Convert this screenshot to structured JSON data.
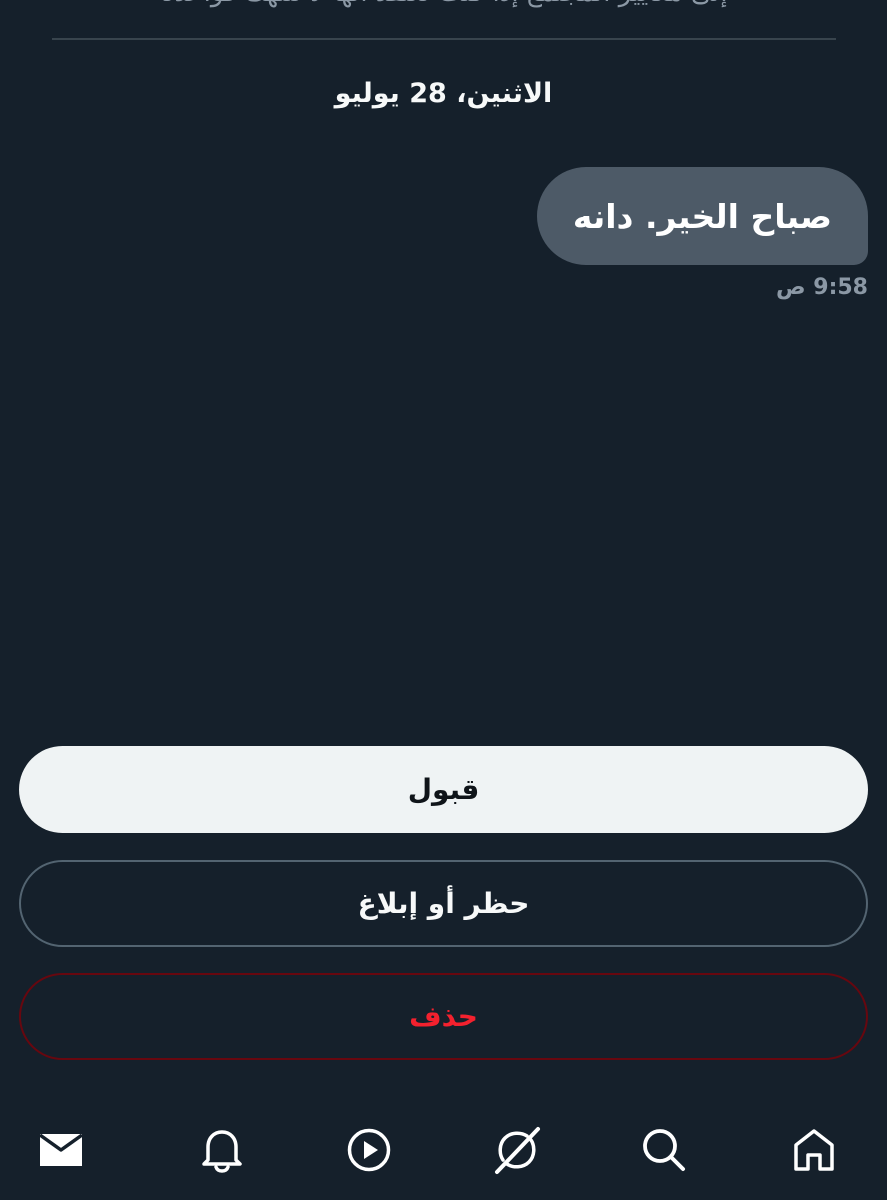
{
  "header": {
    "top_text": "إلى معايير المجتمع إذا كنت تعتقد أنها لا تنتهك قواعدنا"
  },
  "conversation": {
    "date_label": "الاثنين، 28 يوليو",
    "messages": [
      {
        "text": "صباح الخير. دانه",
        "time": "9:58 ص"
      }
    ]
  },
  "actions": {
    "accept_label": "قبول",
    "block_report_label": "حظر أو إبلاغ",
    "delete_label": "حذف"
  },
  "bottom_nav": {
    "items": [
      {
        "icon": "mail-icon",
        "active": true
      },
      {
        "icon": "bell-icon",
        "active": false
      },
      {
        "icon": "play-icon",
        "active": false
      },
      {
        "icon": "grok-icon",
        "active": false
      },
      {
        "icon": "search-icon",
        "active": false
      },
      {
        "icon": "home-icon",
        "active": false
      }
    ]
  },
  "colors": {
    "background": "#15202b",
    "bubble": "#4d5a67",
    "accept_button": "#eff3f4",
    "delete_text": "#f4212e",
    "muted_text": "#8b98a5"
  }
}
